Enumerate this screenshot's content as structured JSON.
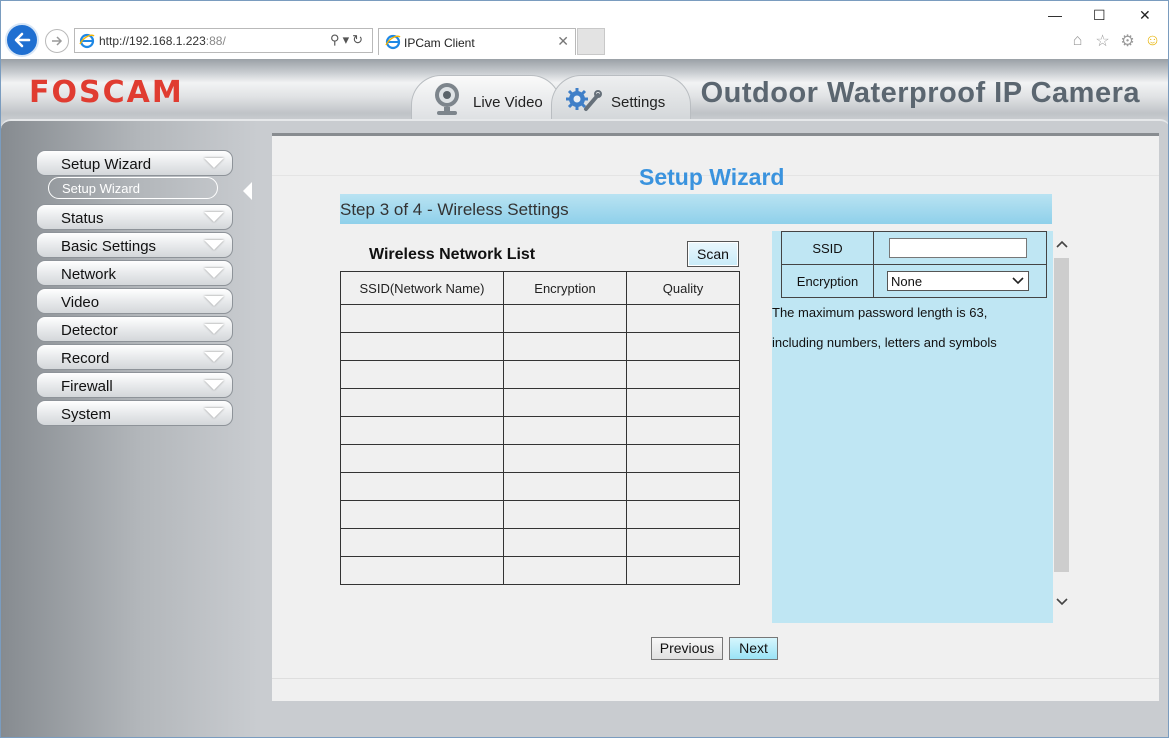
{
  "browser": {
    "url_host": "http://192.168.1.223",
    "url_port": ":88/",
    "tab_title": "IPCam Client",
    "window_controls": [
      "—",
      "☐",
      "✕"
    ],
    "toolbar_icons": [
      "home-icon",
      "star-icon",
      "gear-icon",
      "smiley-icon"
    ]
  },
  "header": {
    "logo": "FOSCAM",
    "tabs": [
      {
        "label": "Live Video",
        "icon": "camera-icon"
      },
      {
        "label": "Settings",
        "icon": "gear-wrench-icon"
      }
    ],
    "camera_model": "Outdoor Waterproof IP Camera"
  },
  "sidebar": {
    "items": [
      {
        "label": "Setup Wizard"
      },
      {
        "label": "Status"
      },
      {
        "label": "Basic Settings"
      },
      {
        "label": "Network"
      },
      {
        "label": "Video"
      },
      {
        "label": "Detector"
      },
      {
        "label": "Record"
      },
      {
        "label": "Firewall"
      },
      {
        "label": "System"
      }
    ],
    "active_sub": "Setup Wizard"
  },
  "wizard": {
    "title": "Setup Wizard",
    "step": "Step 3 of 4 - Wireless Settings",
    "list_title": "Wireless Network List",
    "scan_label": "Scan",
    "columns": [
      "SSID(Network Name)",
      "Encryption",
      "Quality"
    ],
    "rows": 10,
    "form": {
      "ssid_label": "SSID",
      "ssid_value": "",
      "encryption_label": "Encryption",
      "encryption_value": "None"
    },
    "note_line1": "The maximum password length is 63,",
    "note_line2": "including numbers, letters and symbols",
    "prev_label": "Previous",
    "next_label": "Next"
  },
  "colors": {
    "brand": "#e03c31",
    "title_blue": "#3a93de",
    "panel_blue": "#bfe6f3"
  }
}
